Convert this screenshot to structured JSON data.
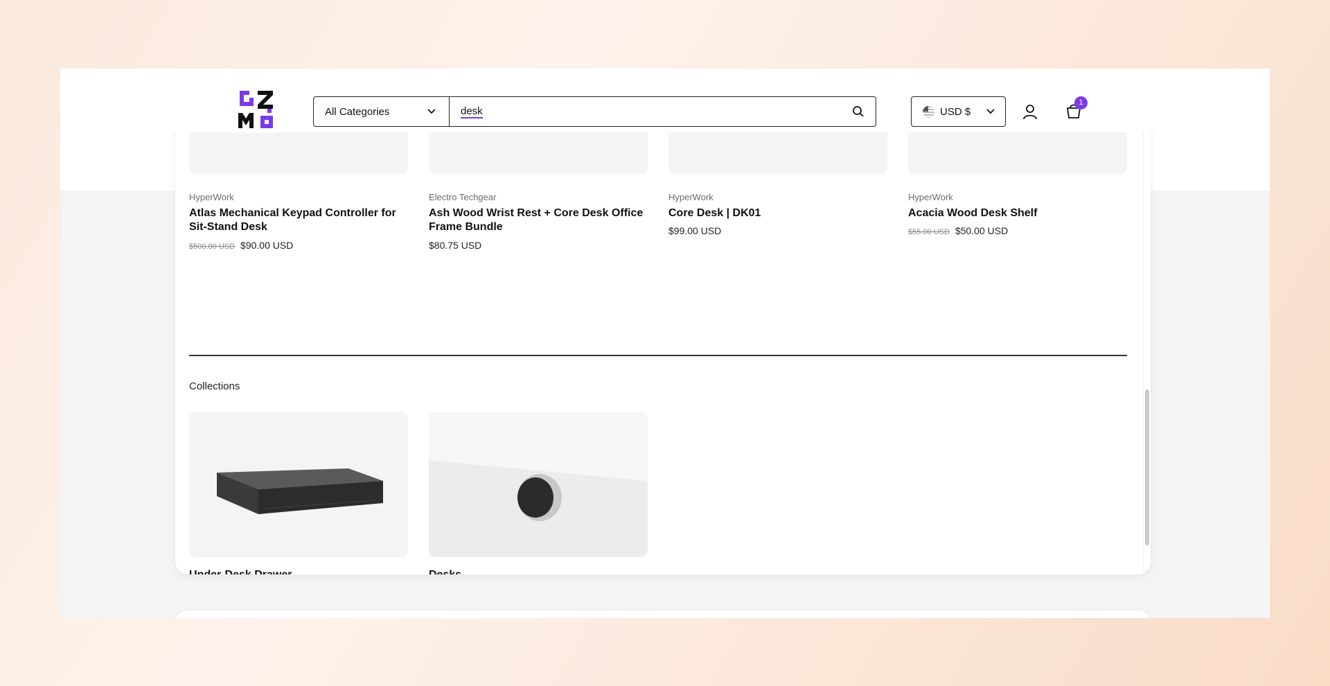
{
  "header": {
    "category_select": "All Categories",
    "search_value": "desk",
    "currency": "USD $",
    "cart_count": "1"
  },
  "products": [
    {
      "vendor": "HyperWork",
      "title": "Atlas Mechanical Keypad Controller for Sit-Stand Desk",
      "compare_price": "$500.00 USD",
      "price": "$90.00 USD"
    },
    {
      "vendor": "Electro Techgear",
      "title": "Ash Wood Wrist Rest + Core Desk Office Frame Bundle",
      "compare_price": "",
      "price": "$80.75 USD"
    },
    {
      "vendor": "HyperWork",
      "title": "Core Desk | DK01",
      "compare_price": "",
      "price": "$99.00 USD"
    },
    {
      "vendor": "HyperWork",
      "title": "Acacia Wood Desk Shelf",
      "compare_price": "$55.00 USD",
      "price": "$50.00 USD"
    }
  ],
  "collections": {
    "heading": "Collections",
    "items": [
      {
        "title": "Under-Desk Drawer"
      },
      {
        "title": "Desks"
      }
    ]
  },
  "colors": {
    "accent": "#7c3aed",
    "border": "#222222"
  },
  "icons": [
    "chevron-down-icon",
    "search-icon",
    "flag-icon",
    "user-icon",
    "cart-icon"
  ]
}
